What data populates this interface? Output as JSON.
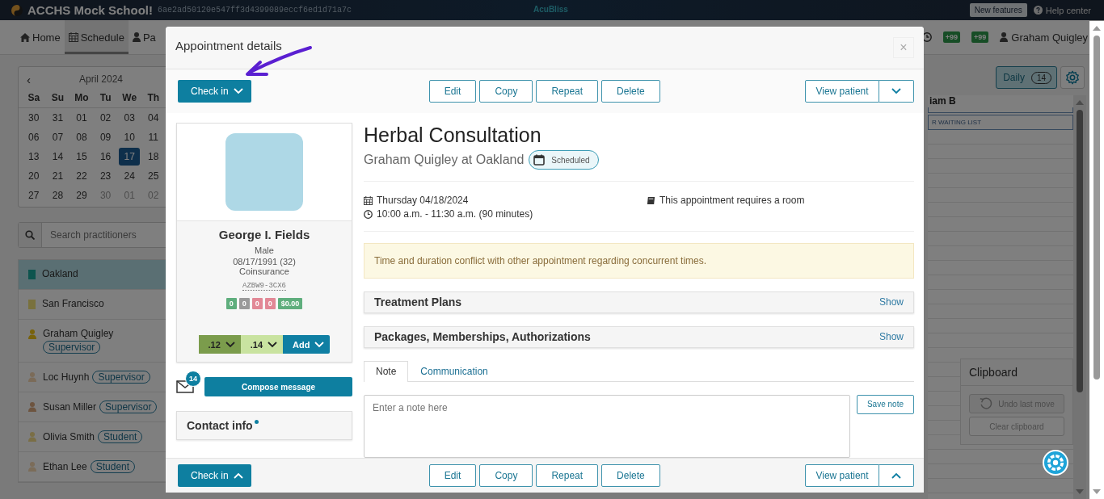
{
  "top_bar": {
    "school": "ACCHS Mock School!",
    "session_id": "6ae2ad50120e547ff3d4399089eccf6ed1d71a7c",
    "brand": "AcuBliss",
    "new_features": "New features",
    "help": "Help center"
  },
  "nav": {
    "items": [
      {
        "label": "Home",
        "selected": false
      },
      {
        "label": "Schedule",
        "selected": true
      },
      {
        "label": "Pa",
        "selected": false
      }
    ],
    "badges": [
      "+99",
      "+99"
    ],
    "user": "Graham Quigley"
  },
  "calendar": {
    "prev": "‹",
    "month": "April 2024",
    "weekdays": [
      "Sa",
      "Su",
      "Mo",
      "Tu",
      "We",
      "Th"
    ],
    "days": [
      {
        "label": "30",
        "muted": false,
        "selected": false
      },
      {
        "label": "31",
        "muted": false,
        "selected": false
      },
      {
        "label": "01",
        "muted": false,
        "selected": false
      },
      {
        "label": "02",
        "muted": false,
        "selected": false
      },
      {
        "label": "03",
        "muted": false,
        "selected": false
      },
      {
        "label": "04",
        "muted": false,
        "selected": false
      },
      {
        "label": "06",
        "muted": false,
        "selected": false
      },
      {
        "label": "07",
        "muted": false,
        "selected": false
      },
      {
        "label": "08",
        "muted": false,
        "selected": false
      },
      {
        "label": "09",
        "muted": false,
        "selected": false
      },
      {
        "label": "10",
        "muted": false,
        "selected": false
      },
      {
        "label": "11",
        "muted": false,
        "selected": false
      },
      {
        "label": "13",
        "muted": false,
        "selected": false
      },
      {
        "label": "14",
        "muted": false,
        "selected": false
      },
      {
        "label": "15",
        "muted": false,
        "selected": false
      },
      {
        "label": "16",
        "muted": false,
        "selected": false
      },
      {
        "label": "17",
        "muted": false,
        "selected": true
      },
      {
        "label": "18",
        "muted": false,
        "selected": false
      },
      {
        "label": "20",
        "muted": false,
        "selected": false
      },
      {
        "label": "21",
        "muted": false,
        "selected": false
      },
      {
        "label": "22",
        "muted": false,
        "selected": false
      },
      {
        "label": "23",
        "muted": false,
        "selected": false
      },
      {
        "label": "24",
        "muted": false,
        "selected": false
      },
      {
        "label": "25",
        "muted": false,
        "selected": false
      },
      {
        "label": "27",
        "muted": false,
        "selected": false
      },
      {
        "label": "28",
        "muted": false,
        "selected": false
      },
      {
        "label": "29",
        "muted": false,
        "selected": false
      },
      {
        "label": "30",
        "muted": true,
        "selected": false
      },
      {
        "label": "01",
        "muted": true,
        "selected": false
      },
      {
        "label": "02",
        "muted": true,
        "selected": false
      }
    ]
  },
  "search": {
    "placeholder": "Search practitioners"
  },
  "practitioners": [
    {
      "name": "Oakland",
      "kind": "location",
      "color": "#0d544e",
      "selected": true
    },
    {
      "name": "San Francisco",
      "kind": "location",
      "color": "#79713d",
      "selected": false
    },
    {
      "name": "Graham Quigley",
      "kind": "person",
      "role": "Supervisor",
      "color": "#78620c",
      "selected": false
    },
    {
      "name": "Loc Huynh",
      "kind": "person",
      "role": "Supervisor",
      "color": "#7b6b58",
      "selected": false
    },
    {
      "name": "Susan Miller",
      "kind": "person",
      "role": "Supervisor",
      "color": "#6d543f",
      "selected": false
    },
    {
      "name": "Olivia Smith",
      "kind": "person",
      "role": "Student",
      "color": "#7a6e45",
      "selected": false
    },
    {
      "name": "Ethan Lee",
      "kind": "person",
      "role": "Student",
      "color": "#7b6c59",
      "selected": false
    }
  ],
  "schedule": {
    "view": "Daily",
    "count": "14",
    "column": "iam B",
    "entries": [
      "R WAITING LIST"
    ]
  },
  "clipboard": {
    "title": "Clipboard",
    "undo": "Undo last move",
    "clear": "Clear clipboard",
    "disabled": true
  },
  "modal": {
    "title": "Appointment details",
    "close": "×",
    "toolbar": {
      "check_in": "Check in",
      "actions": [
        "Edit",
        "Copy",
        "Repeat",
        "Delete"
      ],
      "view_patient": "View patient"
    },
    "patient": {
      "name": "George I. Fields",
      "gender": "Male",
      "dob": "08/17/1991 (32)",
      "insurance": "Coinsurance",
      "code": "AZBW9-3CX6",
      "counters": [
        {
          "label": "0",
          "color": "#5fae7d"
        },
        {
          "label": "0",
          "color": "#9a9a9a"
        },
        {
          "label": "0",
          "color": "#e28896"
        },
        {
          "label": "0",
          "color": "#e28896"
        },
        {
          "label": "$0.00",
          "color": "#5fae7d"
        }
      ],
      "tags": [
        {
          "label": ".12",
          "color": "#7b9c4c"
        },
        {
          "label": ".14",
          "color": "#c9e3a0"
        },
        {
          "label": "Add",
          "color": "#0f7fa3"
        }
      ]
    },
    "messages": {
      "count": "14",
      "compose": "Compose message"
    },
    "contact": {
      "title": "Contact info",
      "unread": true
    },
    "appointment": {
      "title": "Herbal Consultation",
      "subtitle": "Graham Quigley at Oakland",
      "status": "Scheduled",
      "date": "Thursday 04/18/2024",
      "time": "10:00 a.m. - 11:30 a.m. (90 minutes)",
      "room": "This appointment requires a room"
    },
    "alert": "Time and duration conflict with other appointment regarding concurrent times.",
    "sections": [
      {
        "title": "Treatment Plans",
        "action": "Show"
      },
      {
        "title": "Packages, Memberships, Authorizations",
        "action": "Show"
      }
    ],
    "tabs": [
      {
        "label": "Note",
        "selected": true
      },
      {
        "label": "Communication",
        "selected": false
      }
    ],
    "note": {
      "placeholder": "Enter a note here",
      "save": "Save note"
    },
    "footer": {
      "check_in": "Check in",
      "actions": [
        "Edit",
        "Copy",
        "Repeat",
        "Delete"
      ],
      "view_patient": "View patient"
    }
  }
}
